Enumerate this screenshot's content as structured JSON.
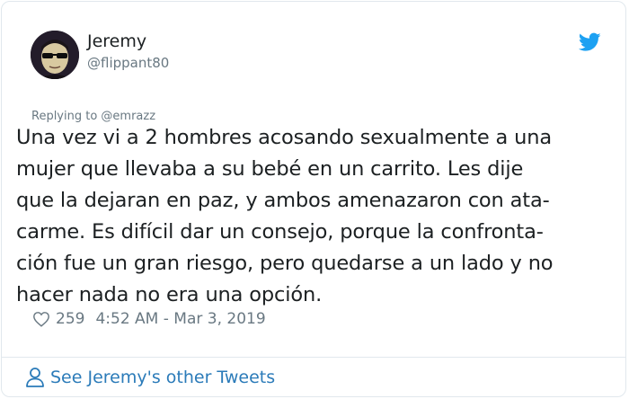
{
  "author": {
    "name": "Jeremy",
    "handle": "@flippant80"
  },
  "reply": {
    "text": "Replying to @emrazz"
  },
  "tweet": {
    "lines": [
      "Una vez vi a 2 hombres acosando sexualmente a una",
      "mujer que llevaba a su bebé en un carrito. Les dije",
      "que la dejaran en paz, y ambos amenazaron con ata-",
      "carme. Es difícil dar un consejo, porque la confronta-",
      "ción fue un gran riesgo, pero quedarse a un lado y no",
      "hacer nada no era una opción."
    ]
  },
  "meta": {
    "likes": "259",
    "timestamp": "4:52 AM - Mar 3, 2019"
  },
  "footer": {
    "link_label": "See Jeremy's other Tweets"
  },
  "icons": {
    "brand": "twitter-bird-icon",
    "like": "heart-icon",
    "profile": "person-icon"
  },
  "colors": {
    "text": "#1c2022",
    "secondary": "#697882",
    "link": "#2b7bb9",
    "brand": "#1da1f2",
    "border": "#e1e8ed"
  }
}
